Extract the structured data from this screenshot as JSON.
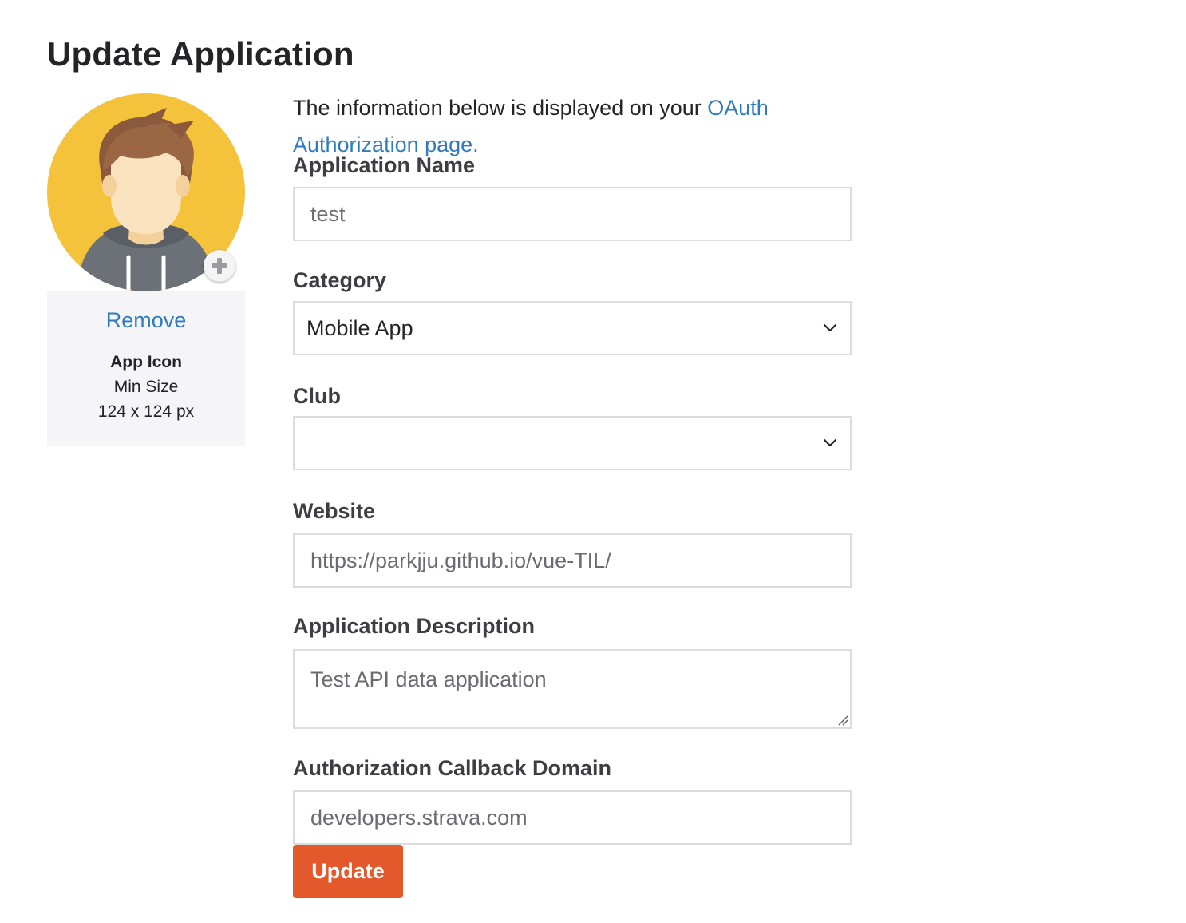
{
  "page": {
    "title": "Update Application"
  },
  "icon_panel": {
    "remove_label": "Remove",
    "icon_label": "App Icon",
    "min_size_label": "Min Size",
    "min_size_value": "124 x 124 px"
  },
  "form": {
    "intro_text": "The information below is displayed on your ",
    "intro_link": "OAuth Authorization page.",
    "app_name": {
      "label": "Application Name",
      "value": "test"
    },
    "category": {
      "label": "Category",
      "value": "Mobile App"
    },
    "club": {
      "label": "Club",
      "value": ""
    },
    "website": {
      "label": "Website",
      "value": "https://parkjju.github.io/vue-TIL/"
    },
    "description": {
      "label": "Application Description",
      "value": "Test API data application"
    },
    "callback_domain": {
      "label": "Authorization Callback Domain",
      "value": "developers.strava.com"
    },
    "update_label": "Update"
  },
  "colors": {
    "link": "#2f7bbf",
    "primary_button": "#e3592c",
    "avatar_background": "#f5c33b",
    "panel_background": "#f5f5f7"
  }
}
